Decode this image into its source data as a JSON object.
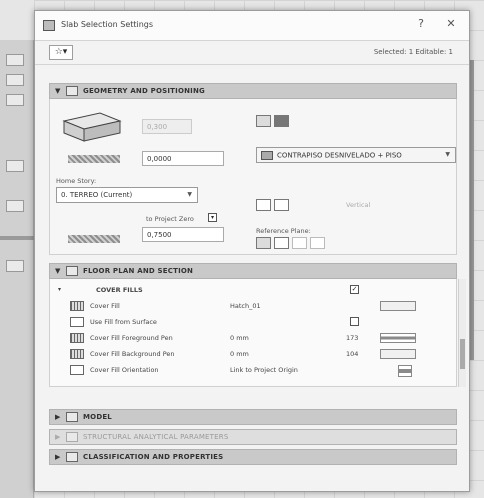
{
  "window": {
    "title": "Slab Selection Settings",
    "help_glyph": "?",
    "close_glyph": "✕"
  },
  "toolbar": {
    "favorites_glyph": "☆▾",
    "selected_text": "Selected: 1 Editable: 1"
  },
  "sections": {
    "geometry": "GEOMETRY AND POSITIONING",
    "floor_plan": "FLOOR PLAN AND SECTION",
    "model": "MODEL",
    "structural": "STRUCTURAL ANALYTICAL PARAMETERS",
    "classification": "CLASSIFICATION AND PROPERTIES"
  },
  "geometry": {
    "thickness_value": "0,300",
    "offset_value": "0,0000",
    "home_story_label": "Home Story:",
    "home_story_value": "0. TERREO (Current)",
    "to_project_zero_label": "to Project Zero",
    "to_project_zero_value": "0,7500",
    "composite_value": "CONTRAPISO DESNIVELADO + PISO",
    "reference_plane_label": "Reference Plane:",
    "edge_value": "Vertical"
  },
  "floor_plan": {
    "cover_fills_label": "COVER FILLS",
    "rows": [
      {
        "name": "Cover Fill",
        "value": "Hatch_01",
        "num": ""
      },
      {
        "name": "Use Fill from Surface",
        "value": "",
        "num": ""
      },
      {
        "name": "Cover Fill Foreground Pen",
        "value": "0 mm",
        "num": "173"
      },
      {
        "name": "Cover Fill Background Pen",
        "value": "0 mm",
        "num": "104"
      },
      {
        "name": "Cover Fill Orientation",
        "value": "Link to Project Origin",
        "num": ""
      }
    ]
  },
  "colors": {
    "section_header": "#c9c9c9",
    "dialog_bg": "#f3f3f3"
  }
}
